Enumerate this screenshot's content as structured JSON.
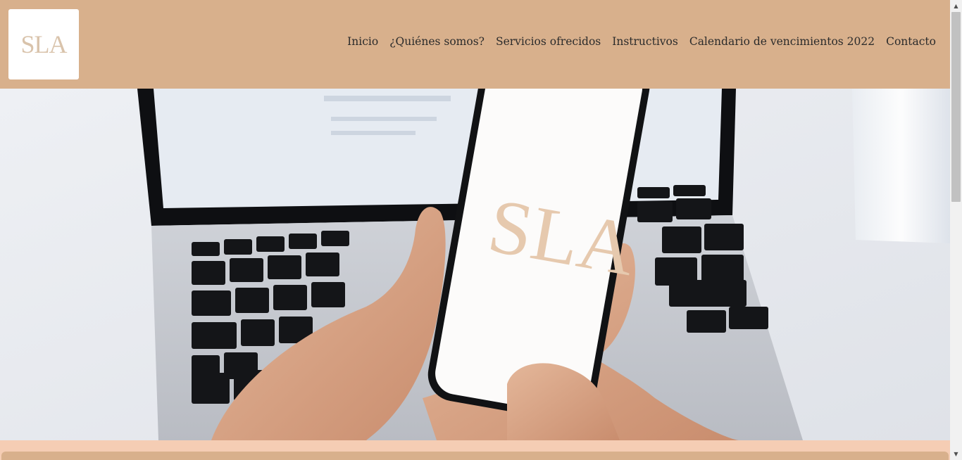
{
  "header": {
    "logo_text": "SLA",
    "nav": [
      {
        "label": "Inicio"
      },
      {
        "label": "¿Quiénes somos?"
      },
      {
        "label": "Servicios ofrecidos"
      },
      {
        "label": "Instructivos"
      },
      {
        "label": "Calendario de vencimientos 2022"
      },
      {
        "label": "Contacto"
      }
    ]
  },
  "hero": {
    "phone_logo_text": "SLA"
  },
  "colors": {
    "header_bg": "#d8b08c",
    "bottom_band": "#f5cdb4",
    "logo_color": "#d9c3ab"
  }
}
